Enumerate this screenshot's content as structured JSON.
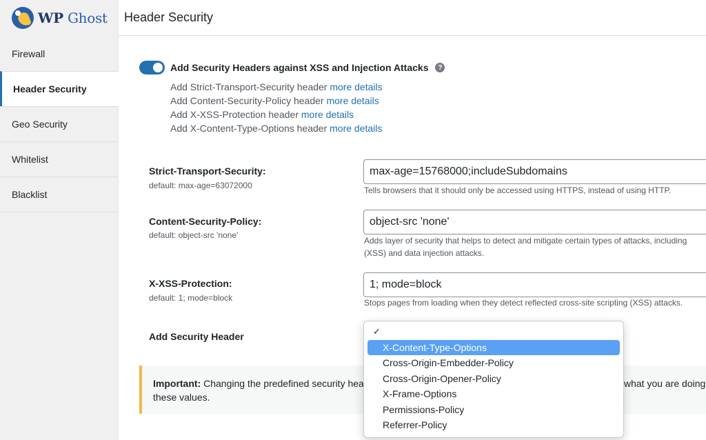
{
  "brand": {
    "logo_word1": "WP",
    "logo_word2": "Ghost"
  },
  "sidebar": {
    "items": [
      {
        "label": "Firewall",
        "active": false
      },
      {
        "label": "Header Security",
        "active": true
      },
      {
        "label": "Geo Security",
        "active": false
      },
      {
        "label": "Whitelist",
        "active": false
      },
      {
        "label": "Blacklist",
        "active": false
      }
    ]
  },
  "header": {
    "title": "Header Security"
  },
  "toggle": {
    "label": "Add Security Headers against XSS and Injection Attacks",
    "enabled": true,
    "help_glyph": "?",
    "items": [
      {
        "text": "Add Strict-Transport-Security header",
        "link": "more details"
      },
      {
        "text": "Add Content-Security-Policy header",
        "link": "more details"
      },
      {
        "text": "Add X-XSS-Protection header",
        "link": "more details"
      },
      {
        "text": "Add X-Content-Type-Options header",
        "link": "more details"
      }
    ]
  },
  "fields": {
    "hsts": {
      "label": "Strict-Transport-Security:",
      "default": "default: max-age=63072000",
      "value": "max-age=15768000;includeSubdomains",
      "help": "Tells browsers that it should only be accessed using HTTPS, instead of using HTTP."
    },
    "csp": {
      "label": "Content-Security-Policy:",
      "default": "default: object-src 'none'",
      "value": "object-src 'none'",
      "help_line1": "Adds layer of security that helps to detect and mitigate certain types of attacks, including",
      "help_line2": "(XSS) and data injection attacks."
    },
    "xss": {
      "label": "X-XSS-Protection:",
      "default": "default: 1; mode=block",
      "value": "1; mode=block",
      "help": "Stops pages from loading when they detect reflected cross-site scripting (XSS) attacks."
    },
    "add_header": {
      "label": "Add Security Header"
    }
  },
  "dropdown": {
    "check_glyph": "✓",
    "options": [
      "X-Content-Type-Options",
      "Cross-Origin-Embedder-Policy",
      "Cross-Origin-Opener-Policy",
      "X-Frame-Options",
      "Permissions-Policy",
      "Referrer-Policy"
    ],
    "highlighted_index": 0
  },
  "notice": {
    "strong": "Important:",
    "text_left": " Changing the predefined security head",
    "text_right": "what you are doing w",
    "line2": "these values."
  },
  "colors": {
    "accent": "#2271b1",
    "notice_border": "#f0b849",
    "highlight": "#5aa0f5"
  }
}
